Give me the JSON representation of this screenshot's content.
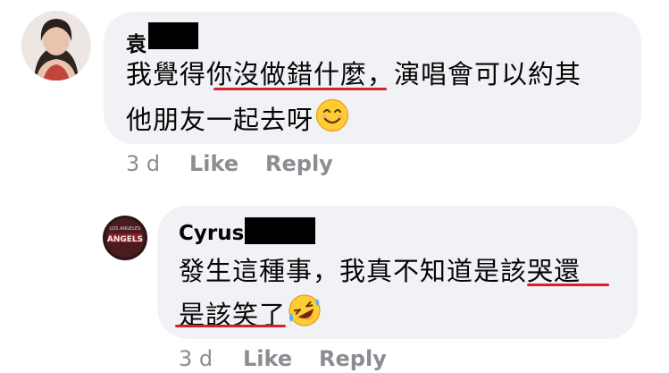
{
  "comments": [
    {
      "author": "袁",
      "line1_plain": "我覺得",
      "line1_underlined": "你沒做錯什麼",
      "line1_tail": "，演唱會可以約其",
      "line2": "他朋友一起去呀",
      "emoji": "smiling-face-icon",
      "time": "3 d",
      "like_label": "Like",
      "reply_label": "Reply"
    },
    {
      "author": "Cyrus",
      "line1_plain": "發生這種事，我真不知道是",
      "line1_underlined": "該哭還",
      "line2_underlined": "是該笑了",
      "emoji": "rofl-face-icon",
      "time": "3 d",
      "like_label": "Like",
      "reply_label": "Reply"
    }
  ],
  "colors": {
    "bubble": "#f0f2f5",
    "underline": "#d8202a",
    "meta": "#8a8d91",
    "text": "#050505"
  }
}
